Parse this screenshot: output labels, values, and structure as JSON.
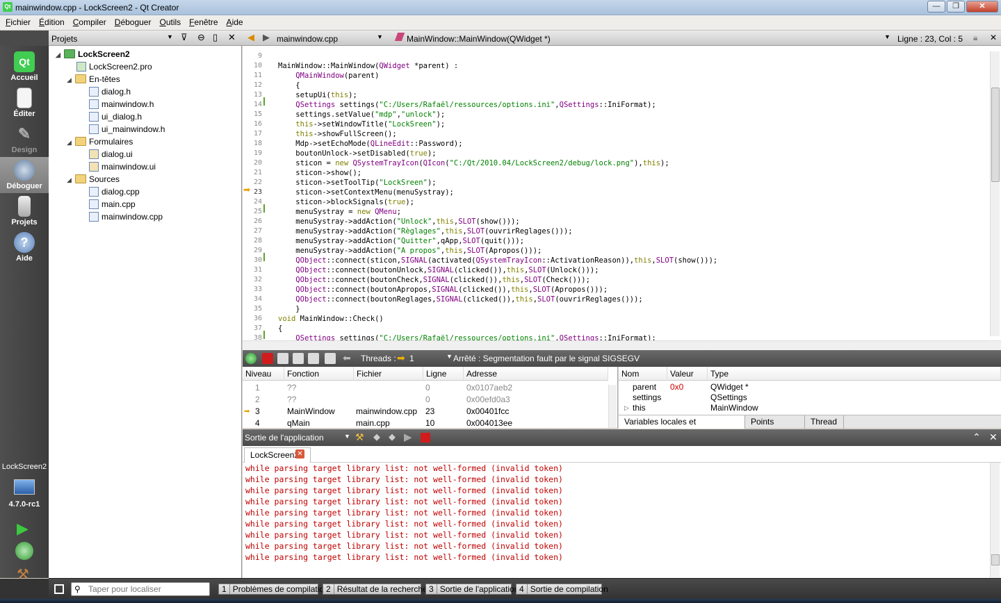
{
  "window": {
    "title": "mainwindow.cpp - LockScreen2 - Qt Creator",
    "minimize": "—",
    "maximize": "❐",
    "close": "✕"
  },
  "menu": [
    "Fichier",
    "Édition",
    "Compiler",
    "Déboguer",
    "Outils",
    "Fenêtre",
    "Aide"
  ],
  "modes": [
    {
      "label": "Accueil",
      "icon": "qt-logo-icon"
    },
    {
      "label": "Éditer",
      "icon": "document-edit-icon"
    },
    {
      "label": "Design",
      "icon": "design-pen-icon"
    },
    {
      "label": "Déboguer",
      "icon": "debug-bug-icon"
    },
    {
      "label": "Projets",
      "icon": "projects-folder-icon"
    },
    {
      "label": "Aide",
      "icon": "help-icon"
    }
  ],
  "target": {
    "project": "LockScreen2",
    "version": "4.7.0-rc1"
  },
  "projects_pane": {
    "title": "Projets"
  },
  "tree": [
    {
      "label": "LockScreen2",
      "type": "project"
    },
    {
      "label": "LockScreen2.pro",
      "type": "pro"
    },
    {
      "label": "En-têtes",
      "type": "folder"
    },
    {
      "label": "dialog.h",
      "type": "header"
    },
    {
      "label": "mainwindow.h",
      "type": "header"
    },
    {
      "label": "ui_dialog.h",
      "type": "header"
    },
    {
      "label": "ui_mainwindow.h",
      "type": "header"
    },
    {
      "label": "Formulaires",
      "type": "folder"
    },
    {
      "label": "dialog.ui",
      "type": "ui"
    },
    {
      "label": "mainwindow.ui",
      "type": "ui"
    },
    {
      "label": "Sources",
      "type": "folder"
    },
    {
      "label": "dialog.cpp",
      "type": "cpp"
    },
    {
      "label": "main.cpp",
      "type": "cpp"
    },
    {
      "label": "mainwindow.cpp",
      "type": "cpp"
    }
  ],
  "editor_toolbar": {
    "file": "mainwindow.cpp",
    "symbol": "MainWindow::MainWindow(QWidget *)",
    "position": "Ligne : 23, Col : 5"
  },
  "line_numbers": [
    "9",
    "10",
    "11",
    "12",
    "13",
    "14",
    "15",
    "16",
    "17",
    "18",
    "19",
    "20",
    "21",
    "22",
    "23",
    "24",
    "25",
    "26",
    "27",
    "28",
    "29",
    "30",
    "31",
    "32",
    "33",
    "34",
    "35",
    "36",
    "37",
    "38"
  ],
  "code_lines": [
    "",
    "MainWindow::MainWindow(QWidget *parent) :",
    "    QMainWindow(parent)",
    "    {",
    "    setupUi(this);",
    "    QSettings settings(\"C:/Users/Rafaël/ressources/options.ini\",QSettings::IniFormat);",
    "    settings.setValue(\"mdp\",\"unlock\");",
    "    this->setWindowTitle(\"LockSreen\");",
    "    this->showFullScreen();",
    "    Mdp->setEchoMode(QLineEdit::Password);",
    "    boutonUnlock->setDisabled(true);",
    "    sticon = new QSystemTrayIcon(QIcon(\"C:/Qt/2010.04/LockScreen2/debug/lock.png\"),this);",
    "    sticon->show();",
    "    sticon->setToolTip(\"LockSreen\");",
    "    sticon->setContextMenu(menuSystray);",
    "    sticon->blockSignals(true);",
    "    menuSystray = new QMenu;",
    "    menuSystray->addAction(\"Unlock\",this,SLOT(show()));",
    "    menuSystray->addAction(\"Règlages\",this,SLOT(ouvrirReglages()));",
    "    menuSystray->addAction(\"Quitter\",qApp,SLOT(quit()));",
    "    menuSystray->addAction(\"A propos\",this,SLOT(Apropos()));",
    "    QObject::connect(sticon,SIGNAL(activated(QSystemTrayIcon::ActivationReason)),this,SLOT(show()));",
    "    QObject::connect(boutonUnlock,SIGNAL(clicked()),this,SLOT(Unlock()));",
    "    QObject::connect(boutonCheck,SIGNAL(clicked()),this,SLOT(Check()));",
    "    QObject::connect(boutonApropos,SIGNAL(clicked()),this,SLOT(Apropos()));",
    "    QObject::connect(boutonReglages,SIGNAL(clicked()),this,SLOT(ouvrirReglages()));",
    "    }",
    "void MainWindow::Check()",
    "{",
    "    QSettings settings(\"C:/Users/Rafaël/ressources/options.ini\",QSettings::IniFormat);"
  ],
  "debug_bar": {
    "threads_label": "Threads :",
    "thread_value": "1",
    "status": "Arrêté : Segmentation fault par le signal SIGSEGV"
  },
  "stack": {
    "headers": [
      "Niveau",
      "Fonction",
      "Fichier",
      "Ligne",
      "Adresse"
    ],
    "rows": [
      {
        "level": "1",
        "func": "??",
        "file": "",
        "line": "0",
        "addr": "0x0107aeb2"
      },
      {
        "level": "2",
        "func": "??",
        "file": "",
        "line": "0",
        "addr": "0x00efd0a3"
      },
      {
        "level": "3",
        "func": "MainWindow",
        "file": "mainwindow.cpp",
        "line": "23",
        "addr": "0x00401fcc"
      },
      {
        "level": "4",
        "func": "qMain",
        "file": "main.cpp",
        "line": "10",
        "addr": "0x004013ee"
      }
    ]
  },
  "locals": {
    "headers": [
      "Nom",
      "Valeur",
      "Type"
    ],
    "rows": [
      {
        "name": "parent",
        "value": "0x0",
        "type": "QWidget *"
      },
      {
        "name": "settings",
        "value": "",
        "type": "QSettings"
      },
      {
        "name": "this",
        "value": "",
        "type": "MainWindow"
      }
    ],
    "tabs": [
      "Variables locales et observateurs",
      "Points d'arrêt",
      "Thread"
    ]
  },
  "output": {
    "title": "Sortie de l'application",
    "tab": "LockScreen2",
    "lines": [
      "while parsing target library list: not well-formed (invalid token)",
      "while parsing target library list: not well-formed (invalid token)",
      "while parsing target library list: not well-formed (invalid token)",
      "while parsing target library list: not well-formed (invalid token)",
      "while parsing target library list: not well-formed (invalid token)",
      "while parsing target library list: not well-formed (invalid token)",
      "while parsing target library list: not well-formed (invalid token)",
      "while parsing target library list: not well-formed (invalid token)",
      "while parsing target library list: not well-formed (invalid token)"
    ]
  },
  "statusbar": {
    "search_placeholder": "Taper pour localiser",
    "tabs": [
      {
        "num": "1",
        "label": "Problèmes de compilation"
      },
      {
        "num": "2",
        "label": "Résultat de la recherche"
      },
      {
        "num": "3",
        "label": "Sortie de l'application"
      },
      {
        "num": "4",
        "label": "Sortie de compilation"
      }
    ]
  }
}
